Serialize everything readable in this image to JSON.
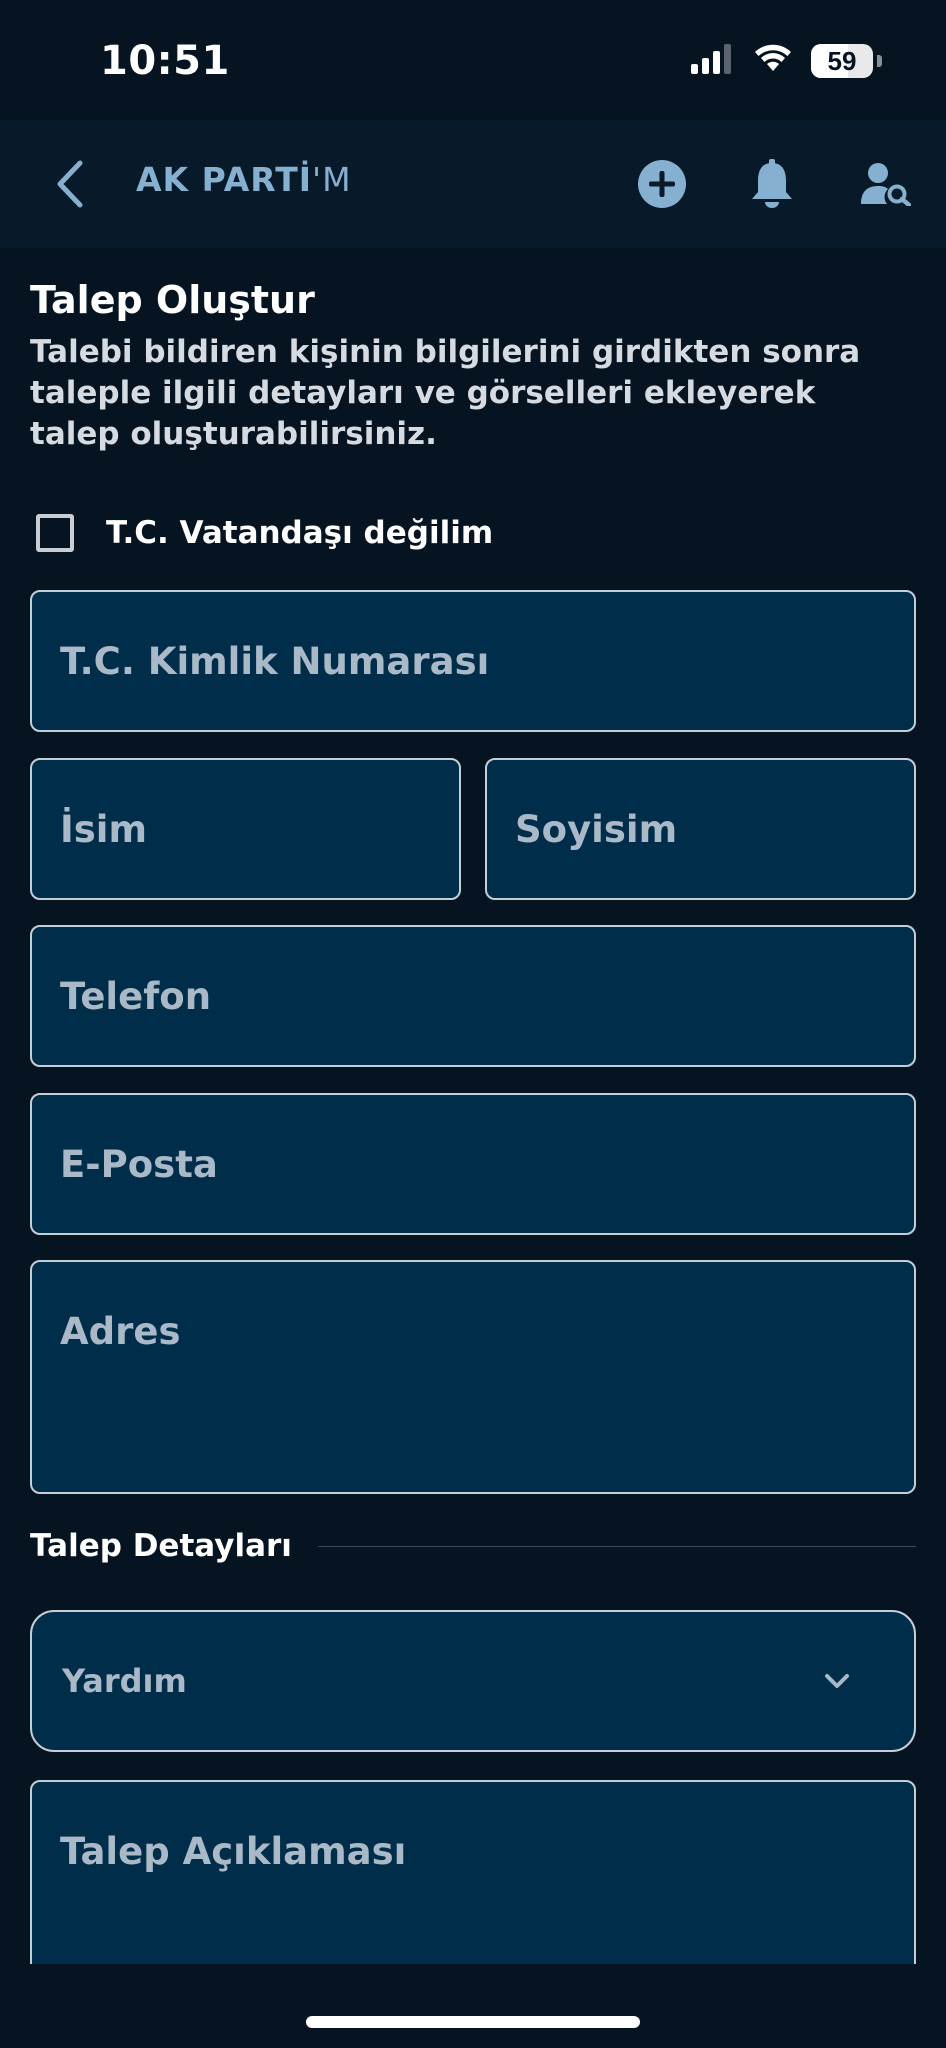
{
  "status_bar": {
    "time": "10:51",
    "battery": "59",
    "battery_level": 0.59,
    "icons": [
      "signal-icon",
      "wifi-icon",
      "battery-icon"
    ]
  },
  "header": {
    "title_main": "AK PARTİ",
    "title_suffix": "'M",
    "actions": [
      "add-circle-icon",
      "bell-icon",
      "user-search-icon"
    ]
  },
  "page": {
    "title": "Talep Oluştur",
    "description": "Talebi bildiren kişinin bilgilerini girdikten sonra taleple ilgili detayları ve görselleri ekleyerek talep oluşturabilirsiniz."
  },
  "form": {
    "not_citizen_label": "T.C. Vatandaşı değilim",
    "not_citizen_checked": false,
    "tc_placeholder": "T.C. Kimlik Numarası",
    "first_name_placeholder": "İsim",
    "last_name_placeholder": "Soyisim",
    "phone_placeholder": "Telefon",
    "email_placeholder": "E-Posta",
    "address_placeholder": "Adres"
  },
  "details": {
    "section_title": "Talep Detayları",
    "type_value": "Yardım",
    "description_placeholder": "Talep Açıklaması"
  },
  "colors": {
    "background": "#061421",
    "header_bg": "#08192a",
    "field_bg": "#002d4a",
    "field_border": "#c5cdd6",
    "accent": "#86b0cf",
    "placeholder": "#a9b9c8"
  }
}
